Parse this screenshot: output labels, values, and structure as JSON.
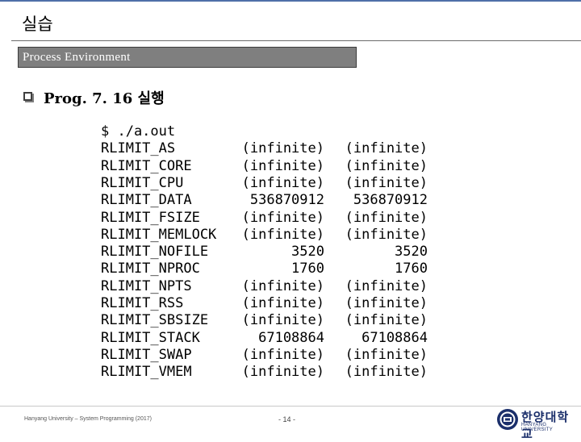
{
  "slide": {
    "title": "실습",
    "section_label": "Process Environment",
    "heading": "Prog. 7. 16 실행"
  },
  "terminal": {
    "command": "$ ./a.out",
    "rows": [
      {
        "name": "RLIMIT_AS",
        "soft": "(infinite)",
        "hard": "(infinite)"
      },
      {
        "name": "RLIMIT_CORE",
        "soft": "(infinite)",
        "hard": "(infinite)"
      },
      {
        "name": "RLIMIT_CPU",
        "soft": "(infinite)",
        "hard": "(infinite)"
      },
      {
        "name": "RLIMIT_DATA",
        "soft": "536870912",
        "hard": "536870912"
      },
      {
        "name": "RLIMIT_FSIZE",
        "soft": "(infinite)",
        "hard": "(infinite)"
      },
      {
        "name": "RLIMIT_MEMLOCK",
        "soft": "(infinite)",
        "hard": "(infinite)"
      },
      {
        "name": "RLIMIT_NOFILE",
        "soft": "3520",
        "hard": "3520"
      },
      {
        "name": "RLIMIT_NPROC",
        "soft": "1760",
        "hard": "1760"
      },
      {
        "name": "RLIMIT_NPTS",
        "soft": "(infinite)",
        "hard": "(infinite)"
      },
      {
        "name": "RLIMIT_RSS",
        "soft": "(infinite)",
        "hard": "(infinite)"
      },
      {
        "name": "RLIMIT_SBSIZE",
        "soft": "(infinite)",
        "hard": "(infinite)"
      },
      {
        "name": "RLIMIT_STACK",
        "soft": "67108864",
        "hard": "67108864"
      },
      {
        "name": "RLIMIT_SWAP",
        "soft": "(infinite)",
        "hard": "(infinite)"
      },
      {
        "name": "RLIMIT_VMEM",
        "soft": "(infinite)",
        "hard": "(infinite)"
      }
    ]
  },
  "footer": {
    "left_text": "Hanyang University – System Programming  (2017)",
    "page": "- 14 -",
    "logo_text": "한양대학교",
    "logo_subtext": "HANYANG UNIVERSITY"
  },
  "colors": {
    "section_bar": "#7f7f7f",
    "top_rule": "#4f6fa8",
    "logo": "#1b2f6b"
  }
}
